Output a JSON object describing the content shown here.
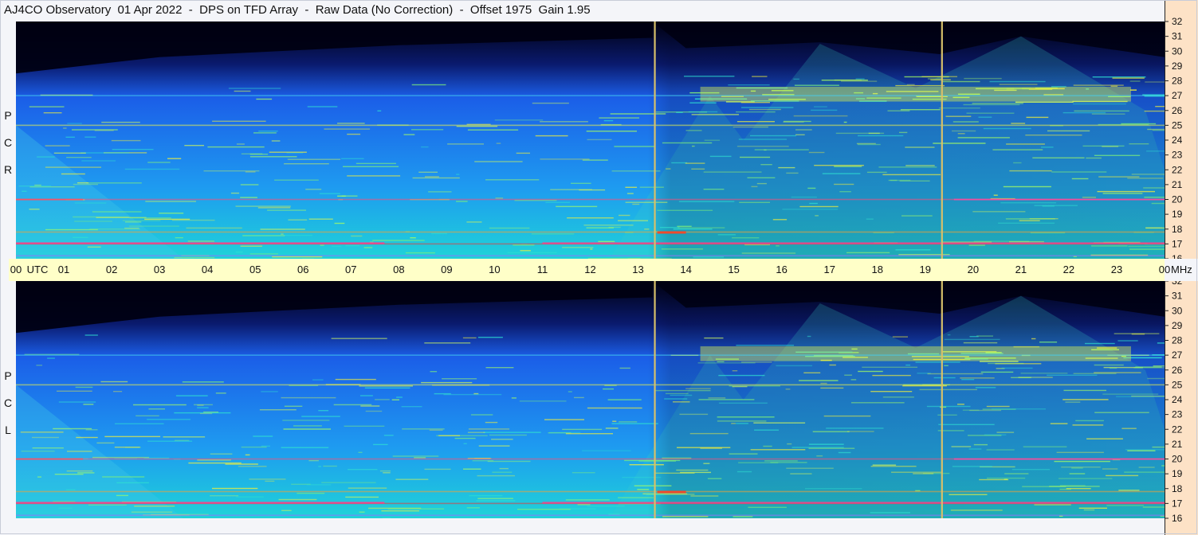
{
  "title": "AJ4CO Observatory  01 Apr 2022  -  DPS on TFD Array  -  Raw Data (No Correction)  -  Offset 1975  Gain 1.95",
  "chart_data": {
    "type": "heatmap",
    "title": "AJ4CO Observatory  01 Apr 2022  -  DPS on TFD Array  -  Raw Data (No Correction)  -  Offset 1975  Gain 1.95",
    "panels": [
      {
        "name": "RCP",
        "label_letters": [
          "P",
          "C",
          "R"
        ]
      },
      {
        "name": "LCP",
        "label_letters": [
          "P",
          "C",
          "L"
        ]
      }
    ],
    "x_axis": {
      "unit_label": "UTC",
      "ticks": [
        "00",
        "01",
        "02",
        "03",
        "04",
        "05",
        "06",
        "07",
        "08",
        "09",
        "10",
        "11",
        "12",
        "13",
        "14",
        "15",
        "16",
        "17",
        "18",
        "19",
        "20",
        "21",
        "22",
        "23",
        "00"
      ],
      "xlim": [
        0,
        24
      ]
    },
    "y_axis": {
      "unit_label": "MHz",
      "ticks": [
        16,
        17,
        18,
        19,
        20,
        21,
        22,
        23,
        24,
        25,
        26,
        27,
        28,
        29,
        30,
        31,
        32
      ],
      "ylim": [
        16,
        32
      ]
    },
    "markers_utc": [
      13.35,
      19.35
    ],
    "intensity_colormap": [
      "#000010",
      "#0a1a6e",
      "#1b5ee8",
      "#1e9bf0",
      "#1fd3d8",
      "#7ef07a",
      "#f2ef3a",
      "#ff5a2a",
      "#ffffff"
    ],
    "interference_bands_mhz": [
      27.0,
      25.0,
      20.0,
      17.8,
      17.0,
      16.2
    ],
    "features": [
      {
        "kind": "dark_upper_band",
        "freq_min": 28.5,
        "utc_start": 0,
        "utc_end": 13.3
      },
      {
        "kind": "bright_arc_peak",
        "utc": 16.8,
        "freq": 30.5
      },
      {
        "kind": "bright_arc_peak",
        "utc": 21.0,
        "freq": 31.0
      }
    ]
  }
}
